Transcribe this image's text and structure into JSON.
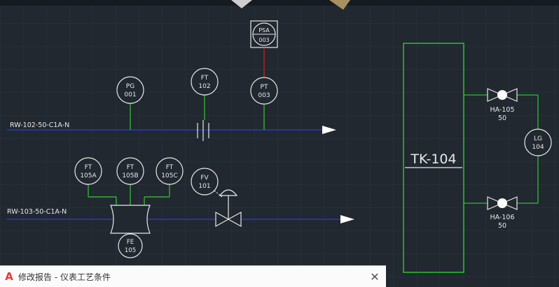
{
  "colors": {
    "background": "#212830",
    "grid": "#2b3440",
    "pipe": "#1e36a8",
    "signal": "#33b233",
    "signal_alt": "#c02020",
    "instrument": "#e8e8e8",
    "tank": "#28c428"
  },
  "pipes": {
    "line1": "RW-102-50-C1A-N",
    "line2": "RW-103-50-C1A-N"
  },
  "instruments": {
    "psa": {
      "tag": "PSA",
      "num": "003"
    },
    "pg": {
      "tag": "PG",
      "num": "001"
    },
    "ft102": {
      "tag": "FT",
      "num": "102"
    },
    "pt": {
      "tag": "PT",
      "num": "003"
    },
    "ft105a": {
      "tag": "FT",
      "num": "105A"
    },
    "ft105b": {
      "tag": "FT",
      "num": "105B"
    },
    "ft105c": {
      "tag": "FT",
      "num": "105C"
    },
    "fv": {
      "tag": "FV",
      "num": "101"
    },
    "fe": {
      "tag": "FE",
      "num": "105"
    },
    "lg": {
      "tag": "LG",
      "num": "104"
    }
  },
  "tank": {
    "label": "TK-104"
  },
  "valves": {
    "ha105": {
      "tag": "HA-105",
      "size": "50"
    },
    "ha106": {
      "tag": "HA-106",
      "size": "50"
    }
  },
  "status_bar": {
    "app_icon": "autocad-logo-icon",
    "logo_text": "A",
    "title": "修改报告 - 仪表工艺条件",
    "close_icon": "close-icon",
    "close_glyph": "✕"
  }
}
